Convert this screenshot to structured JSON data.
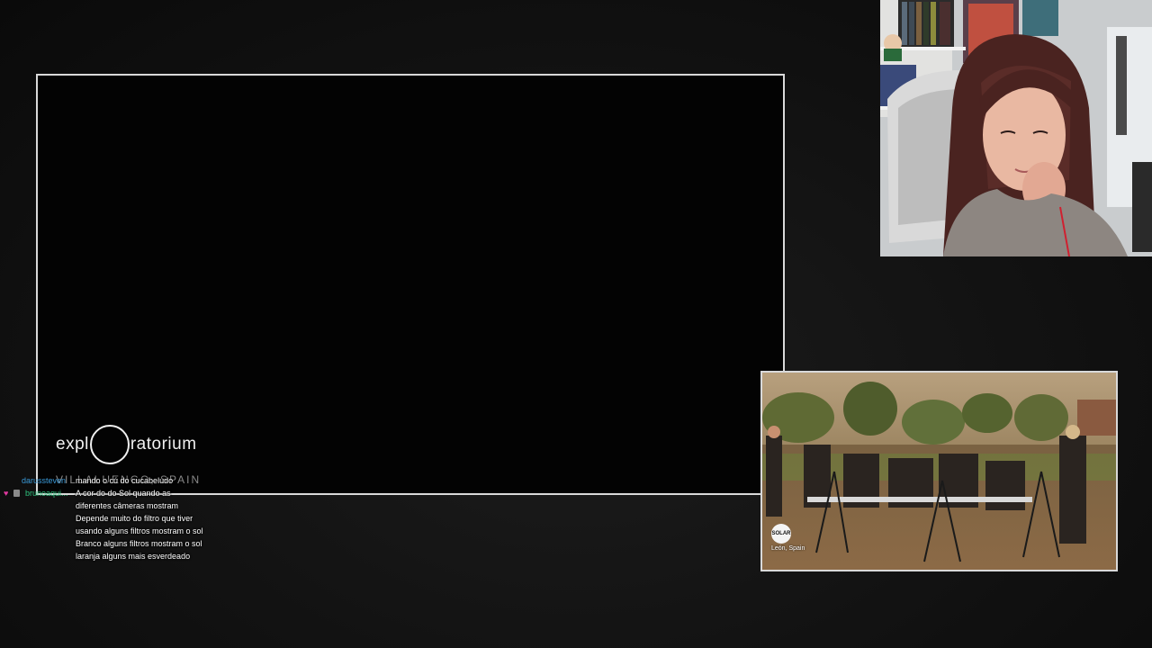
{
  "main_feed": {
    "logo_left": "expl",
    "logo_right": "ratorium",
    "location": "VILLALUENGO, SPAIN"
  },
  "second_feed": {
    "badge": "SOLAR",
    "location": "León, Spain"
  },
  "chat": {
    "messages": [
      {
        "user": "darussteven",
        "user_color": "#3a9ad9",
        "text": "mando o cú do cucabeludo"
      },
      {
        "user": "brunoaqui...",
        "user_color": "#2ec27e",
        "text": "A cor do do Sol quando as"
      },
      {
        "user": "",
        "text": "diferentes câmeras mostram"
      },
      {
        "user": "",
        "text": "Depende muito do filtro que tiver"
      },
      {
        "user": "",
        "text": "usando alguns filtros mostram o sol"
      },
      {
        "user": "",
        "text": "Branco alguns filtros mostram o sol"
      },
      {
        "user": "",
        "text": "laranja alguns mais esverdeado"
      }
    ]
  },
  "icons": {
    "heart_badge": "heart-icon",
    "sub_badge": "subscriber-badge-icon"
  }
}
